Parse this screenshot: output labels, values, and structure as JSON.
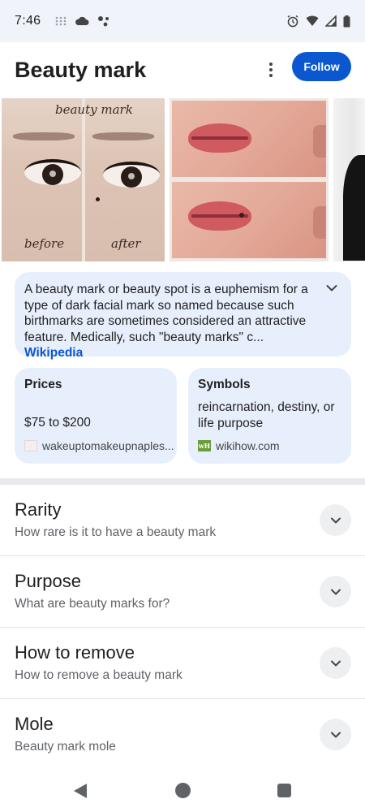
{
  "status_bar": {
    "time": "7:46",
    "left_icons": [
      "grid-dots-icon",
      "cloud-icon",
      "assistant-dots-icon"
    ],
    "right_icons": [
      "alarm-icon",
      "wifi-icon",
      "cell-signal-icon",
      "battery-icon"
    ]
  },
  "header": {
    "title": "Beauty mark",
    "follow_label": "Follow"
  },
  "images": {
    "image1_labels": {
      "top": "beauty mark",
      "before": "before",
      "after": "after"
    }
  },
  "description": {
    "text": "A beauty mark or beauty spot is a euphemism for a type of dark facial mark so named because such birthmarks are sometimes considered an attractive feature. Medically, such \"beauty marks\" c",
    "ellipsis": "... ",
    "source_link": "Wikipedia"
  },
  "info_cards": [
    {
      "title": "Prices",
      "value": "$75 to $200",
      "source": "wakeuptomakeupnaples..."
    },
    {
      "title": "Symbols",
      "value": "reincarnation, destiny, or life purpose",
      "source": "wikihow.com"
    }
  ],
  "accordion": [
    {
      "title": "Rarity",
      "subtitle": "How rare is it to have a beauty mark"
    },
    {
      "title": "Purpose",
      "subtitle": "What are beauty marks for?"
    },
    {
      "title": "How to remove",
      "subtitle": "How to remove a beauty mark"
    },
    {
      "title": "Mole",
      "subtitle": "Beauty mark mole"
    }
  ],
  "colors": {
    "accent": "#0b57d0",
    "card_bg": "#e8effc",
    "status_bg": "#f0f4fa"
  }
}
